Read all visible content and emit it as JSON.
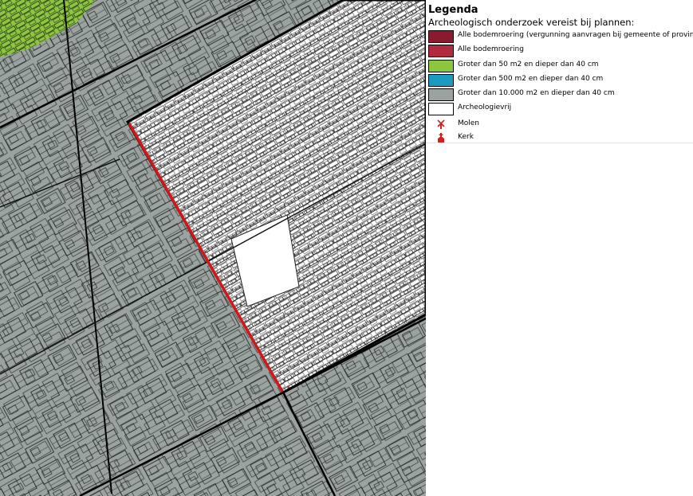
{
  "legend": {
    "title": "Legenda",
    "subtitle": "Archeologisch onderzoek vereist bij plannen:",
    "items": [
      {
        "label": "Alle bodemroering (vergunning aanvragen bij gemeente of provincie)",
        "color": "#8b1a2e",
        "kind": "swatch"
      },
      {
        "label": "Alle bodemroering",
        "color": "#b12a3e",
        "kind": "swatch"
      },
      {
        "label": "Groter dan 50 m2 en dieper dan 40 cm",
        "color": "#8cc63f",
        "kind": "swatch"
      },
      {
        "label": "Groter dan 500 m2 en dieper dan 40 cm",
        "color": "#1a9bbf",
        "kind": "swatch"
      },
      {
        "label": "Groter dan 10.000 m2 en dieper dan 40 cm",
        "color": "#9aa39f",
        "kind": "swatch"
      },
      {
        "label": "Archeologievrij",
        "color": "#ffffff",
        "kind": "swatch"
      },
      {
        "label": "Molen",
        "color": "#d22020",
        "kind": "symbol",
        "icon": "windmill-icon"
      },
      {
        "label": "Kerk",
        "color": "#d22020",
        "kind": "symbol",
        "icon": "church-icon"
      }
    ]
  },
  "map": {
    "zone_colors": {
      "groter_dan_10000": "#9aa39f",
      "groter_dan_50": "#8cc63f",
      "archeologievrij": "#ffffff",
      "alle_bodemroering": "#d01818"
    }
  }
}
